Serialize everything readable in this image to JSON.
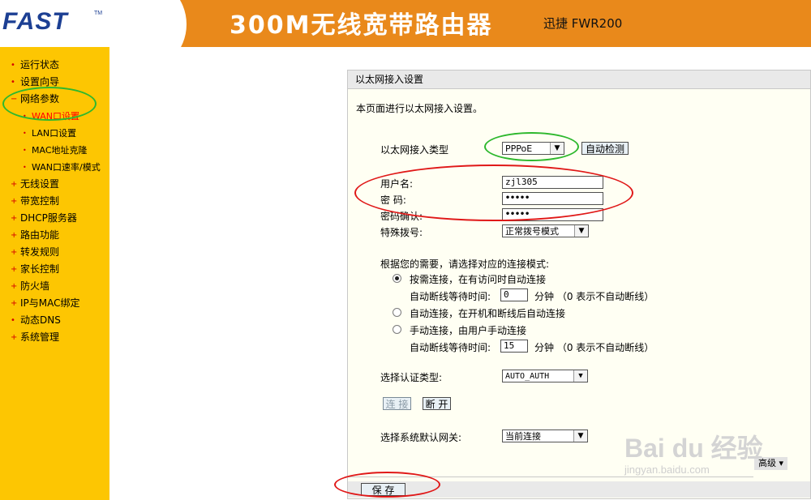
{
  "header": {
    "logo": "FAST",
    "logo_tm": "TM",
    "title": "300M无线宽带路由器",
    "model": "迅捷 FWR200",
    "bg_color": "#e9891b"
  },
  "sidebar": {
    "bg_color": "#fdc602",
    "items": [
      {
        "bullet": "•",
        "label": "运行状态"
      },
      {
        "bullet": "•",
        "label": "设置向导"
      },
      {
        "bullet": "−",
        "label": "网络参数"
      },
      {
        "bullet": "•",
        "label": "WAN口设置"
      },
      {
        "bullet": "•",
        "label": "LAN口设置"
      },
      {
        "bullet": "•",
        "label": "MAC地址克隆"
      },
      {
        "bullet": "•",
        "label": "WAN口速率/模式"
      },
      {
        "bullet": "+",
        "label": "无线设置"
      },
      {
        "bullet": "+",
        "label": "带宽控制"
      },
      {
        "bullet": "+",
        "label": "DHCP服务器"
      },
      {
        "bullet": "+",
        "label": "路由功能"
      },
      {
        "bullet": "+",
        "label": "转发规则"
      },
      {
        "bullet": "+",
        "label": "家长控制"
      },
      {
        "bullet": "+",
        "label": "防火墙"
      },
      {
        "bullet": "+",
        "label": "IP与MAC绑定"
      },
      {
        "bullet": "•",
        "label": "动态DNS"
      },
      {
        "bullet": "+",
        "label": "系统管理"
      }
    ]
  },
  "main": {
    "panel_title": "以太网接入设置",
    "intro": "本页面进行以太网接入设置。",
    "wan_type_label": "以太网接入类型",
    "wan_type_value": "PPPoE",
    "auto_detect_button": "自动检测",
    "username_label": "用户名:",
    "username_value": "zjl305",
    "password_label": "密  码:",
    "password_value": "•••••",
    "confirm_label": "密码确认:",
    "confirm_value": "•••••",
    "special_dial_label": "特殊拨号:",
    "special_dial_value": "正常拨号模式",
    "mode_prompt": "根据您的需要，请选择对应的连接模式:",
    "mode_on_demand": "按需连接，在有访问时自动连接",
    "idle_label_1": "自动断线等待时间:",
    "idle_value_1": "0",
    "idle_unit_1": "分钟 （0 表示不自动断线）",
    "mode_auto": "自动连接，在开机和断线后自动连接",
    "mode_manual": "手动连接，由用户手动连接",
    "idle_label_2": "自动断线等待时间:",
    "idle_value_2": "15",
    "idle_unit_2": "分钟 （0 表示不自动断线）",
    "auth_label": "选择认证类型:",
    "auth_value": "AUTO_AUTH",
    "connect_button": "连 接",
    "disconnect_button": "断 开",
    "gateway_label": "选择系统默认网关:",
    "gateway_value": "当前连接",
    "advanced_button": "高级",
    "save_button": "保 存",
    "selected_mode": "on_demand"
  },
  "watermark": {
    "main": "Bai du 经验",
    "sub": "jingyan.baidu.com"
  }
}
